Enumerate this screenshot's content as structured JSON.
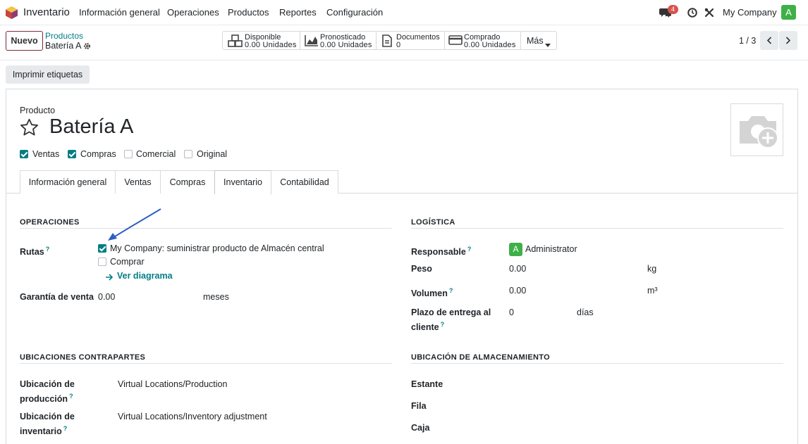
{
  "navbar": {
    "app_name": "Inventario",
    "menu": [
      "Información general",
      "Operaciones",
      "Productos",
      "Reportes",
      "Configuración"
    ],
    "chat_count": "4",
    "company": "My Company",
    "user_initial": "A"
  },
  "control_panel": {
    "new_button": "Nuevo",
    "breadcrumb_parent": "Productos",
    "breadcrumb_current": "Batería A",
    "stats": [
      {
        "label": "Disponible",
        "value": "0.00 Unidades"
      },
      {
        "label": "Pronosticado",
        "value": "0.00 Unidades"
      },
      {
        "label": "Documentos",
        "value": "0"
      },
      {
        "label": "Comprado",
        "value": "0.00 Unidades"
      }
    ],
    "more_button": "Más",
    "pager": "1 / 3"
  },
  "actions": {
    "print_labels": "Imprimir etiquetas"
  },
  "form": {
    "product_label": "Producto",
    "product_name": "Batería A",
    "flags": [
      {
        "label": "Ventas",
        "checked": true
      },
      {
        "label": "Compras",
        "checked": true
      },
      {
        "label": "Comercial",
        "checked": false
      },
      {
        "label": "Original",
        "checked": false
      }
    ],
    "tabs": [
      "Información general",
      "Ventas",
      "Compras",
      "Inventario",
      "Contabilidad"
    ],
    "active_tab": "Inventario",
    "operations": {
      "title": "OPERACIONES",
      "routes_label": "Rutas",
      "routes": [
        {
          "label": "My Company: suministrar producto de Almacén central",
          "checked": true
        },
        {
          "label": "Comprar",
          "checked": false
        }
      ],
      "diagram_link": "Ver diagrama",
      "warranty_label": "Garantía de venta",
      "warranty_value": "0.00",
      "warranty_unit": "meses"
    },
    "logistics": {
      "title": "LOGÍSTICA",
      "responsible_label": "Responsable",
      "responsible_initial": "A",
      "responsible_value": "Administrator",
      "weight_label": "Peso",
      "weight_value": "0.00",
      "weight_unit": "kg",
      "volume_label": "Volumen",
      "volume_value": "0.00",
      "volume_unit": "m³",
      "lead_label_1": "Plazo de entrega al",
      "lead_label_2": "cliente",
      "lead_value": "0",
      "lead_unit": "días"
    },
    "counterpart": {
      "title": "UBICACIONES CONTRAPARTES",
      "production_label_1": "Ubicación de",
      "production_label_2": "producción",
      "production_value": "Virtual Locations/Production",
      "inventory_label_1": "Ubicación de",
      "inventory_label_2": "inventario",
      "inventory_value": "Virtual Locations/Inventory adjustment"
    },
    "storage": {
      "title": "UBICACIÓN DE ALMACENAMIENTO",
      "shelf_label": "Estante",
      "row_label": "Fila",
      "box_label": "Caja"
    }
  },
  "help_mark": "?"
}
